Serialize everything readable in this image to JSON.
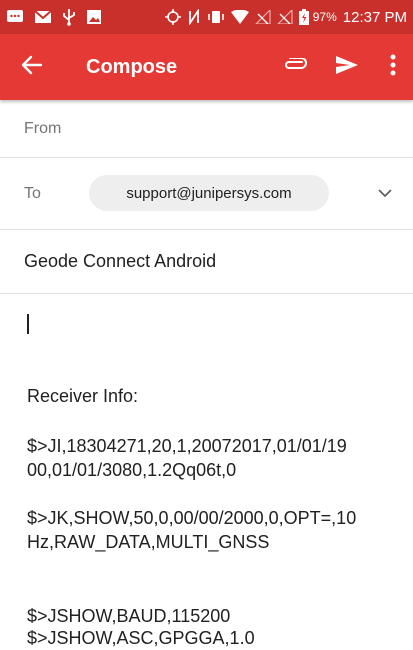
{
  "status_bar": {
    "battery": "97%",
    "time": "12:37 PM",
    "icons": [
      "messages-icon",
      "gmail-icon",
      "usb-icon",
      "image-icon",
      "gps-icon",
      "nfc-icon",
      "vibrate-icon",
      "wifi-icon",
      "no-signal-icon",
      "no-signal-icon",
      "battery-charging-icon"
    ]
  },
  "app_bar": {
    "title": "Compose",
    "background": "#e53935",
    "actions": [
      "attach-icon",
      "send-icon",
      "more-vert-icon"
    ]
  },
  "from": {
    "label": "From"
  },
  "to": {
    "label": "To",
    "recipient": "support@junipersys.com"
  },
  "subject": {
    "value": "Geode Connect Android"
  },
  "body": {
    "lines": [
      "Receiver Info:",
      "$>JI,18304271,20,1,20072017,01/01/19",
      "00,01/01/3080,1.2Qq06t,0",
      "$>JK,SHOW,50,0,00/00/2000,0,OPT=,10",
      "Hz,RAW_DATA,MULTI_GNSS",
      "$>JSHOW,BAUD,115200",
      "$>JSHOW,ASC,GPGGA,1.0"
    ]
  }
}
